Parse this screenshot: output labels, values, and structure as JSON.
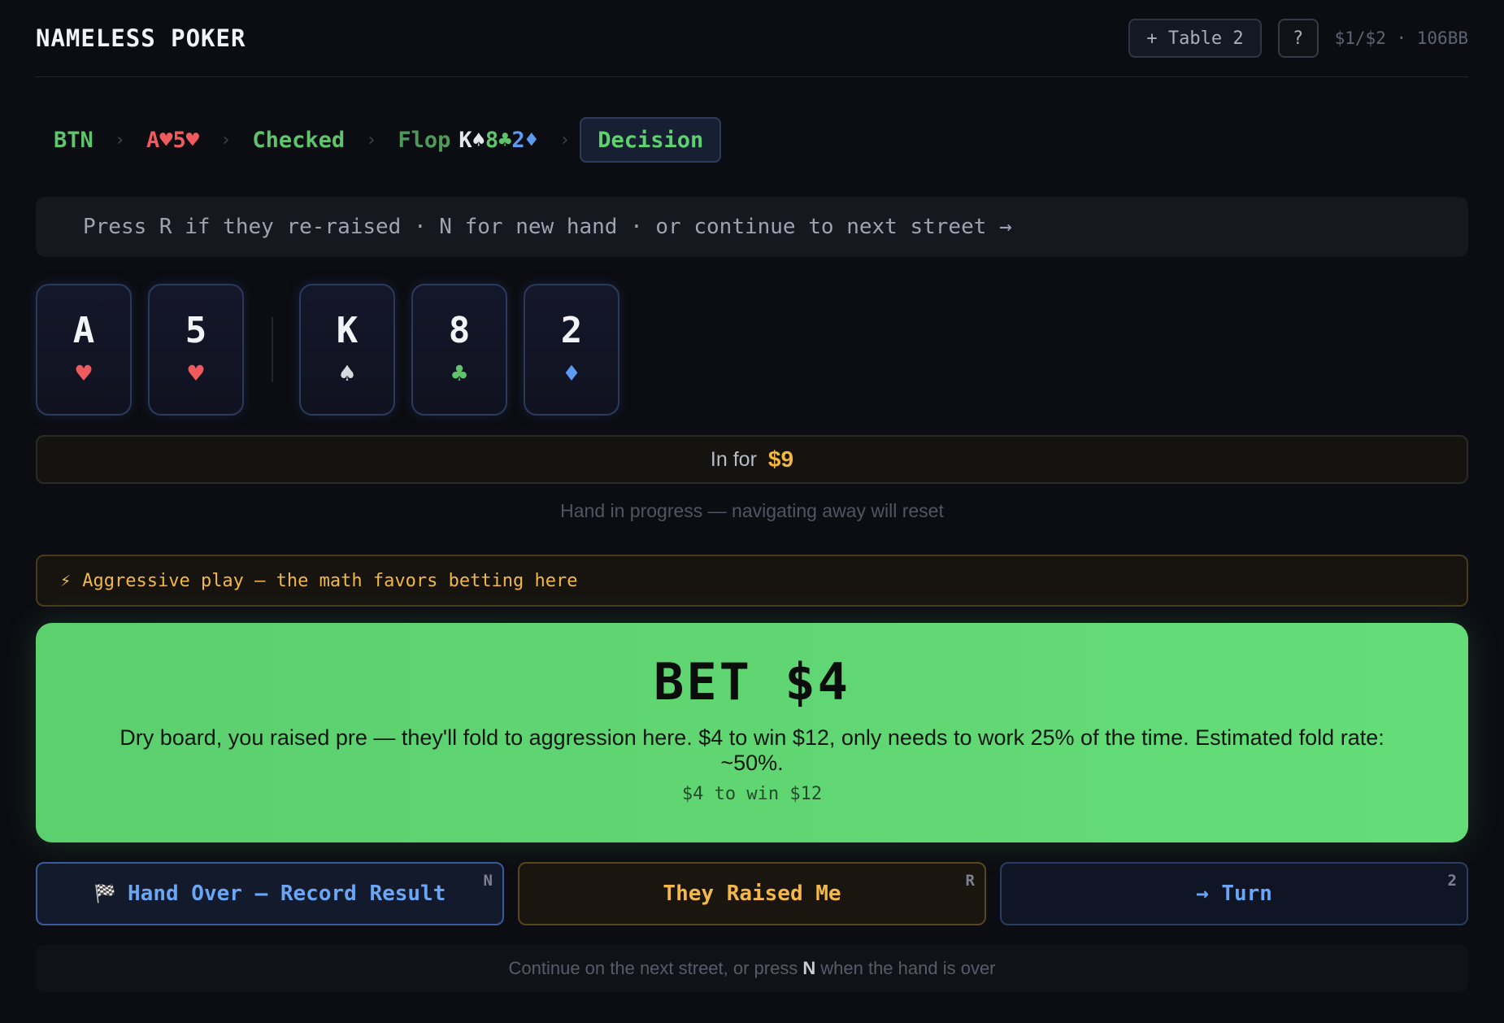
{
  "app": {
    "title": "NAMELESS POKER"
  },
  "header": {
    "new_table_label": "+ Table 2",
    "help_label": "?",
    "stakes": "$1/$2 · 106BB"
  },
  "breadcrumb": {
    "position": "BTN",
    "hand": "A♥5♥",
    "preflop_action": "Checked",
    "flop_label": "Flop",
    "flop_cards": [
      {
        "text": "K♠",
        "color": "#e6e8ee"
      },
      {
        "text": "8♣",
        "color": "#5fc46d"
      },
      {
        "text": "2♦",
        "color": "#5c9bf0"
      }
    ],
    "current": "Decision",
    "separator": "›"
  },
  "hint": "Press R if they re-raised · N for new hand · or continue to next street →",
  "hole_cards": [
    {
      "rank": "A",
      "suit": "♥",
      "suit_name": "heart-icon",
      "color": "#ef5a5f"
    },
    {
      "rank": "5",
      "suit": "♥",
      "suit_name": "heart-icon",
      "color": "#ef5a5f"
    }
  ],
  "board_cards": [
    {
      "rank": "K",
      "suit": "♠",
      "suit_name": "spade-icon",
      "color": "#d7d9de"
    },
    {
      "rank": "8",
      "suit": "♣",
      "suit_name": "club-icon",
      "color": "#5fc46d"
    },
    {
      "rank": "2",
      "suit": "♦",
      "suit_name": "diamond-icon",
      "color": "#5c9bf0"
    }
  ],
  "invested": {
    "label": "In for",
    "amount": "$9"
  },
  "progress_note": "Hand in progress — navigating away will reset",
  "advice": {
    "icon": "⚡",
    "text": "Aggressive play — the math favors betting here"
  },
  "recommendation": {
    "action": "BET $4",
    "description": "Dry board, you raised pre — they'll fold to aggression here. $4 to win $12, only needs to work 25% of the time. Estimated fold rate: ~50%.",
    "odds": "$4 to win $12"
  },
  "actions": {
    "hand_over": {
      "icon": "🏁",
      "label": "Hand Over — Record Result",
      "key": "N"
    },
    "raised": {
      "label": "They Raised Me",
      "key": "R"
    },
    "turn": {
      "label": "→ Turn",
      "key": "2"
    }
  },
  "footer": {
    "before": "Continue on the next street, or press",
    "key": "N",
    "after": "when the hand is over"
  },
  "colors": {
    "accent_green": "#5fc46d",
    "bet_green": "#5ccf6e",
    "warning_gold": "#f0b84a",
    "link_blue": "#6aa6f5",
    "heart_red": "#ef5a5f"
  }
}
